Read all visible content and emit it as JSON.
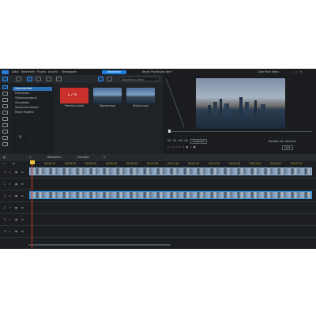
{
  "menubar": {
    "menu_items": [
      "Datei",
      "Bearbeiten",
      "Plugins",
      "Ansicht",
      "Wiedergabe"
    ],
    "edit_label": "Bearbeiten",
    "title": "Neues Projekt.pds Neu*",
    "user": "Clear Moin Mena"
  },
  "library": {
    "search_placeholder": "Bibliothek suchen",
    "categories": [
      "Stammordner",
      "Fehlmedien",
      "Titelsequenzbuch",
      "Sounddatei",
      "Verwandte-Medien",
      "Meine Projekte"
    ],
    "items": [
      {
        "caption": "Premium-Inhalt"
      },
      {
        "caption": "Skyliner.mp4"
      },
      {
        "caption": "Skyline.mp4"
      }
    ]
  },
  "preview": {
    "timecode": "00 : 00 : 00 : 00",
    "fit_label": "Anpassen",
    "render_label": "Rendern der Vorschau",
    "quality_label": "2D/3"
  },
  "timeline": {
    "tab_labels": [
      "Bearbeiten",
      "Erzeugen"
    ],
    "ruler": [
      "00;00;00",
      "00;00;10",
      "00;00;20",
      "00;00;30",
      "00;00;40",
      "00;00;50",
      "00;01;00",
      "00;01;10",
      "00;01;20",
      "00;01;30",
      "00;01;40",
      "00;01;50",
      "00;02;00",
      "00;02;10",
      "00;02;20"
    ],
    "tracks": [
      "1",
      "1",
      "2",
      "2",
      "3",
      "3"
    ]
  }
}
